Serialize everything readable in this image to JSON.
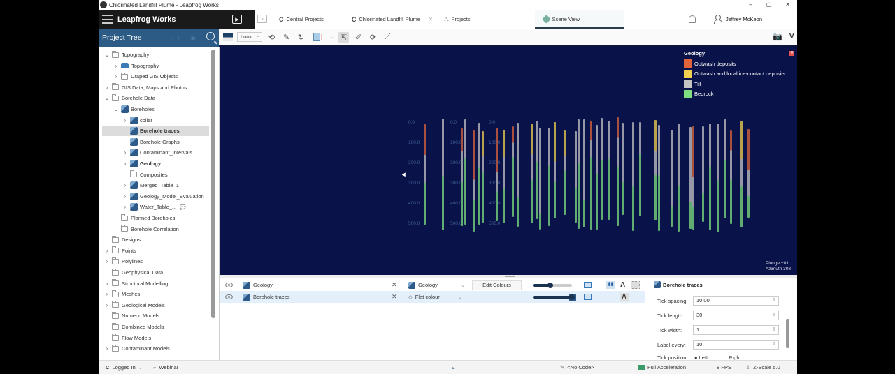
{
  "window": {
    "title": "Chlorinated Landfill Plume - Leapfrog Works",
    "controls": [
      "–",
      "▢",
      "✕"
    ]
  },
  "brand": {
    "name": "Leapfrog Works"
  },
  "tabs": [
    {
      "label": "Central Projects",
      "icon": "central-icon",
      "closable": false,
      "active": false
    },
    {
      "label": "Chlorinated Landfill Plume",
      "icon": "central-icon",
      "closable": true,
      "active": false
    },
    {
      "label": "Projects",
      "icon": "projects-icon",
      "closable": false,
      "active": false
    },
    {
      "label": "Scene View",
      "icon": "scene-icon",
      "closable": false,
      "active": true
    }
  ],
  "user": {
    "name": "Jeffrey McKeon"
  },
  "project_tree": {
    "title": "Project Tree",
    "items": [
      {
        "label": "Topography",
        "level": 0,
        "expander": "open",
        "icon": "folder"
      },
      {
        "label": "Topography",
        "level": 1,
        "expander": "closed",
        "icon": "topography"
      },
      {
        "label": "Draped GIS Objects",
        "level": 1,
        "expander": "closed",
        "icon": "folder"
      },
      {
        "label": "GIS Data, Maps and Photos",
        "level": 0,
        "expander": "closed",
        "icon": "folder"
      },
      {
        "label": "Borehole Data",
        "level": 0,
        "expander": "open",
        "icon": "folder"
      },
      {
        "label": "Boreholes",
        "level": 1,
        "expander": "open",
        "icon": "data"
      },
      {
        "label": "collar",
        "level": 2,
        "expander": "closed",
        "icon": "data"
      },
      {
        "label": "Borehole traces",
        "level": 2,
        "expander": "none",
        "icon": "data",
        "selected": true,
        "bold": true
      },
      {
        "label": "Borehole Graphs",
        "level": 2,
        "expander": "none",
        "icon": "data"
      },
      {
        "label": "Contaminant_Intervals",
        "level": 2,
        "expander": "closed",
        "icon": "data"
      },
      {
        "label": "Geology",
        "level": 2,
        "expander": "closed",
        "icon": "data",
        "bold": true
      },
      {
        "label": "Composites",
        "level": 2,
        "expander": "none",
        "icon": "folder"
      },
      {
        "label": "Merged_Table_1",
        "level": 2,
        "expander": "closed",
        "icon": "data"
      },
      {
        "label": "Geology_Model_Evaluation",
        "level": 2,
        "expander": "closed",
        "icon": "data"
      },
      {
        "label": "Water_Table_...",
        "level": 2,
        "expander": "closed",
        "icon": "data",
        "comment": true
      },
      {
        "label": "Planned Boreholes",
        "level": 1,
        "expander": "none",
        "icon": "folder"
      },
      {
        "label": "Borehole Correlation",
        "level": 1,
        "expander": "none",
        "icon": "folder"
      },
      {
        "label": "Designs",
        "level": 0,
        "expander": "none",
        "icon": "folder"
      },
      {
        "label": "Points",
        "level": 0,
        "expander": "closed",
        "icon": "folder"
      },
      {
        "label": "Polylines",
        "level": 0,
        "expander": "closed",
        "icon": "folder"
      },
      {
        "label": "Geophysical Data",
        "level": 0,
        "expander": "none",
        "icon": "folder"
      },
      {
        "label": "Structural Modelling",
        "level": 0,
        "expander": "closed",
        "icon": "folder"
      },
      {
        "label": "Meshes",
        "level": 0,
        "expander": "closed",
        "icon": "folder"
      },
      {
        "label": "Geological Models",
        "level": 0,
        "expander": "closed",
        "icon": "folder"
      },
      {
        "label": "Numeric Models",
        "level": 0,
        "expander": "none",
        "icon": "folder"
      },
      {
        "label": "Combined Models",
        "level": 0,
        "expander": "none",
        "icon": "folder"
      },
      {
        "label": "Flow Models",
        "level": 0,
        "expander": "none",
        "icon": "folder"
      },
      {
        "label": "Contaminant Models",
        "level": 0,
        "expander": "closed",
        "icon": "folder"
      }
    ]
  },
  "toolbar": {
    "view_mode": "Look"
  },
  "scene": {
    "legend": {
      "title": "Geology",
      "items": [
        {
          "label": "Outwash deposits",
          "color": "#e0643c"
        },
        {
          "label": "Outwash and local ice-contact deposits",
          "color": "#f3d150"
        },
        {
          "label": "Till",
          "color": "#c4c4c4"
        },
        {
          "label": "Bedrock",
          "color": "#7ee07e"
        }
      ]
    },
    "orientation": {
      "plunge": "Plunge +01",
      "azimuth": "Azimuth 308"
    },
    "depth_labels": [
      "0.0",
      "100.0",
      "200.0",
      "300.0",
      "400.0",
      "500.0"
    ]
  },
  "shapes": [
    {
      "name": "Geology",
      "colour_mode": "Geology",
      "action": "Edit Colours",
      "opacity": 0.45,
      "selected": false
    },
    {
      "name": "Borehole traces",
      "colour_mode": "Flat colour",
      "swatch": "#2d5a88",
      "opacity": 1.0,
      "selected": true
    }
  ],
  "properties": {
    "title": "Borehole traces",
    "fields": [
      {
        "label": "Tick spacing:",
        "value": "10.00"
      },
      {
        "label": "Tick length:",
        "value": "30"
      },
      {
        "label": "Tick width:",
        "value": "1"
      },
      {
        "label": "Label every:",
        "value": "10"
      }
    ],
    "tick_position": {
      "label": "Tick position:",
      "options": [
        "Left",
        "Right"
      ],
      "selected": "Left"
    }
  },
  "statusbar": {
    "login": "Logged In",
    "webinar": "Webinar",
    "code": "<No Code>",
    "acceleration": "Full Acceleration",
    "fps": "8 FPS",
    "zscale": "Z-Scale 5.0"
  }
}
